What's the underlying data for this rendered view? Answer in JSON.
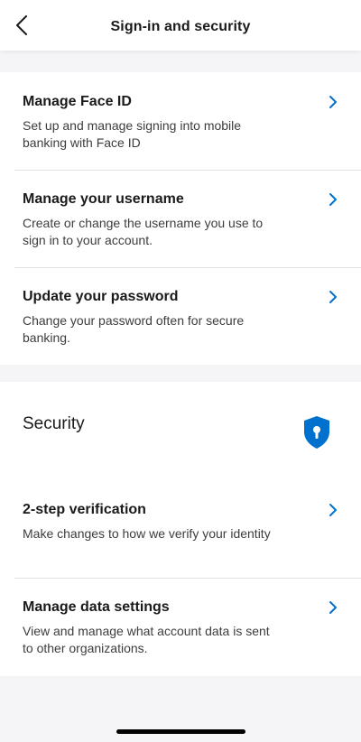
{
  "header": {
    "title": "Sign-in and security",
    "back_icon": "chevron-left-icon"
  },
  "signin": {
    "items": [
      {
        "title": "Manage Face ID",
        "description": "Set up and manage signing into mobile banking with Face ID",
        "icon": "chevron-right-icon"
      },
      {
        "title": "Manage your username",
        "description": "Create or change the username you use to sign in to your account.",
        "icon": "chevron-right-icon"
      },
      {
        "title": "Update your password",
        "description": "Change your password often for secure banking.",
        "icon": "chevron-right-icon"
      }
    ]
  },
  "security": {
    "heading": "Security",
    "icon": "shield-lock-icon",
    "items": [
      {
        "title": "2-step verification",
        "description": "Make changes to how we verify your identity",
        "icon": "chevron-right-icon"
      },
      {
        "title": "Manage data settings",
        "description": "View and manage what account data is sent to other organizations.",
        "icon": "chevron-right-icon"
      }
    ]
  },
  "colors": {
    "accent": "#0071ce",
    "background": "#f5f5f7",
    "card": "#ffffff",
    "divider": "#e2e2e2"
  }
}
